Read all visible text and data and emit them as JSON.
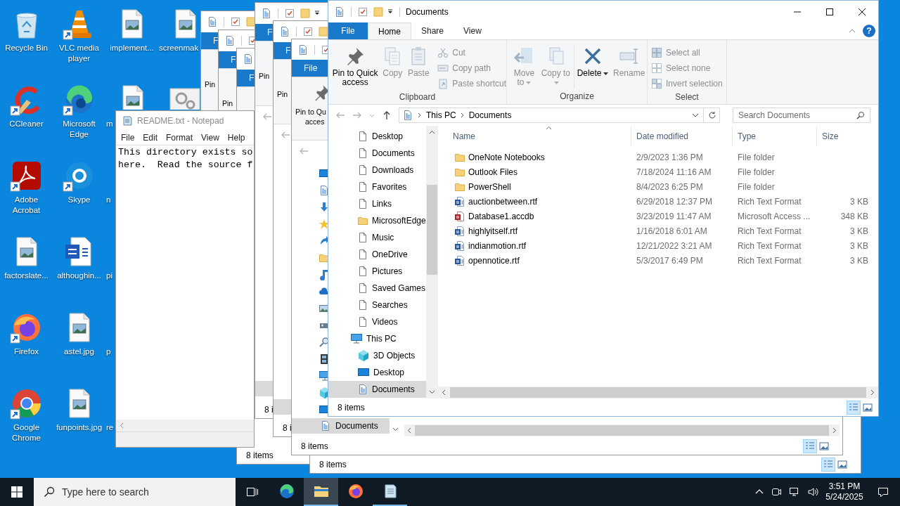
{
  "desktop_icons": [
    {
      "label": "Recycle Bin",
      "shortcut": false
    },
    {
      "label": "CCleaner",
      "shortcut": true
    },
    {
      "label": "Adobe Acrobat",
      "shortcut": true
    },
    {
      "label": "factorslate...",
      "shortcut": false
    },
    {
      "label": "Firefox",
      "shortcut": true
    },
    {
      "label": "Google Chrome",
      "shortcut": true
    },
    {
      "label": "VLC media player",
      "shortcut": true
    },
    {
      "label": "Microsoft Edge",
      "shortcut": true
    },
    {
      "label": "Skype",
      "shortcut": true
    },
    {
      "label": "althoughin...",
      "shortcut": false
    },
    {
      "label": "astel.jpg",
      "shortcut": false
    },
    {
      "label": "funpoints.jpg",
      "shortcut": false
    },
    {
      "label": "implement...",
      "shortcut": false
    },
    {
      "label": "m",
      "shortcut": false
    },
    {
      "label": "n"
    },
    {
      "label": "pi"
    },
    {
      "label": "p"
    },
    {
      "label": "re"
    },
    {
      "label": "screenmak",
      "shortcut": false
    },
    {
      "shortcut": false
    }
  ],
  "background_windows": [
    {
      "file_tab": "F",
      "ribbon_text": [
        "Pin"
      ]
    },
    {
      "file_tab": "F",
      "ribbon_text": [
        "Pin"
      ]
    },
    {
      "file_tab": "F",
      "status": "8 items"
    },
    {
      "file_tab": "F",
      "ribbon_text": [
        "Pin"
      ],
      "status": "8 i"
    },
    {
      "file_tab": "F",
      "ribbon_text": [
        "Pin"
      ],
      "status": "8 i"
    },
    {
      "status": "8 items"
    },
    {
      "file_tab": "File",
      "ribbon_text": [
        "Pin to Qu",
        "acces"
      ],
      "nav_selected": "Documents",
      "status": "8 items"
    }
  ],
  "notepad": {
    "title": "README.txt - Notepad",
    "menu": [
      "File",
      "Edit",
      "Format",
      "View",
      "Help"
    ],
    "lines": [
      "This directory exists so",
      "here.  Read the source f"
    ]
  },
  "explorer": {
    "title": "Documents",
    "tabs": [
      {
        "label": "File",
        "kind": "menu"
      },
      {
        "label": "Home",
        "kind": "tab",
        "selected": true
      },
      {
        "label": "Share",
        "kind": "tab",
        "selected": false
      },
      {
        "label": "View",
        "kind": "tab",
        "selected": false
      }
    ],
    "help": "?",
    "ribbon": [
      {
        "label": "Clipboard",
        "buttons": [
          {
            "label": "Pin to Quick access",
            "kind": "large",
            "disabled": false,
            "dropdown": false
          },
          {
            "label": "Copy",
            "kind": "large",
            "disabled": true,
            "dropdown": false
          },
          {
            "label": "Paste",
            "kind": "large",
            "disabled": true,
            "dropdown": false
          },
          {
            "label": "Cut",
            "kind": "small",
            "disabled": true,
            "dropdown": false
          },
          {
            "label": "Copy path",
            "kind": "small",
            "disabled": true,
            "dropdown": false
          },
          {
            "label": "Paste shortcut",
            "kind": "small",
            "disabled": true,
            "dropdown": false
          }
        ]
      },
      {
        "label": "Organize",
        "buttons": [
          {
            "label": "Move to",
            "kind": "large",
            "disabled": true,
            "dropdown": true
          },
          {
            "label": "Copy to",
            "kind": "large",
            "disabled": true,
            "dropdown": true
          },
          {
            "label": "Delete",
            "kind": "large",
            "disabled": false,
            "dropdown": true
          },
          {
            "label": "Rename",
            "kind": "large",
            "disabled": true,
            "dropdown": false
          }
        ]
      },
      {
        "label": "Select",
        "buttons": [
          {
            "label": "Select all",
            "kind": "small",
            "disabled": true,
            "dropdown": false
          },
          {
            "label": "Select none",
            "kind": "small",
            "disabled": true,
            "dropdown": false
          },
          {
            "label": "Invert selection",
            "kind": "small",
            "disabled": true,
            "dropdown": false
          }
        ]
      }
    ],
    "address": {
      "crumbs": [
        "This PC",
        "Documents"
      ]
    },
    "search": {
      "placeholder": "Search Documents"
    },
    "nav": [
      {
        "label": "Desktop",
        "selected": false
      },
      {
        "label": "Documents",
        "selected": false
      },
      {
        "label": "Downloads",
        "selected": false
      },
      {
        "label": "Favorites",
        "selected": false
      },
      {
        "label": "Links",
        "selected": false
      },
      {
        "label": "MicrosoftEdge",
        "selected": false
      },
      {
        "label": "Music",
        "selected": false
      },
      {
        "label": "OneDrive",
        "selected": false
      },
      {
        "label": "Pictures",
        "selected": false
      },
      {
        "label": "Saved Games",
        "selected": false
      },
      {
        "label": "Searches",
        "selected": false
      },
      {
        "label": "Videos",
        "selected": false
      },
      {
        "label": "This PC",
        "selected": false,
        "children": [
          {
            "label": "3D Objects",
            "selected": false
          },
          {
            "label": "Desktop",
            "selected": false
          },
          {
            "label": "Documents",
            "selected": true
          }
        ]
      }
    ],
    "columns": [
      "Name",
      "Date modified",
      "Type",
      "Size"
    ],
    "files": [
      {
        "name": "OneNote Notebooks",
        "date": "2/9/2023 1:36 PM",
        "type": "File folder",
        "kind": "folder"
      },
      {
        "name": "Outlook Files",
        "date": "7/18/2024 11:16 AM",
        "type": "File folder",
        "kind": "folder"
      },
      {
        "name": "PowerShell",
        "date": "8/4/2023 6:25 PM",
        "type": "File folder",
        "kind": "folder"
      },
      {
        "name": "auctionbetween.rtf",
        "date": "6/29/2018 12:37 PM",
        "type": "Rich Text Format",
        "size": "3 KB",
        "kind": "rtf"
      },
      {
        "name": "Database1.accdb",
        "date": "3/23/2019 11:47 AM",
        "type": "Microsoft Access ...",
        "size": "348 KB",
        "kind": "access"
      },
      {
        "name": "highlyitself.rtf",
        "date": "1/16/2018 6:01 AM",
        "type": "Rich Text Format",
        "size": "3 KB",
        "kind": "rtf"
      },
      {
        "name": "indianmotion.rtf",
        "date": "12/21/2022 3:21 AM",
        "type": "Rich Text Format",
        "size": "3 KB",
        "kind": "rtf"
      },
      {
        "name": "opennotice.rtf",
        "date": "5/3/2017 6:49 PM",
        "type": "Rich Text Format",
        "size": "3 KB",
        "kind": "rtf"
      }
    ],
    "status": "8 items",
    "view_buttons": [
      {
        "selected": true
      },
      {
        "selected": false
      }
    ]
  },
  "taskbar": {
    "search_placeholder": "Type here to search",
    "apps": [
      {
        "running": false,
        "active": false
      },
      {
        "running": true,
        "active": true
      },
      {
        "running": false,
        "active": false
      },
      {
        "running": true,
        "active": false
      }
    ],
    "time": "3:51 PM",
    "date": "5/24/2025"
  }
}
